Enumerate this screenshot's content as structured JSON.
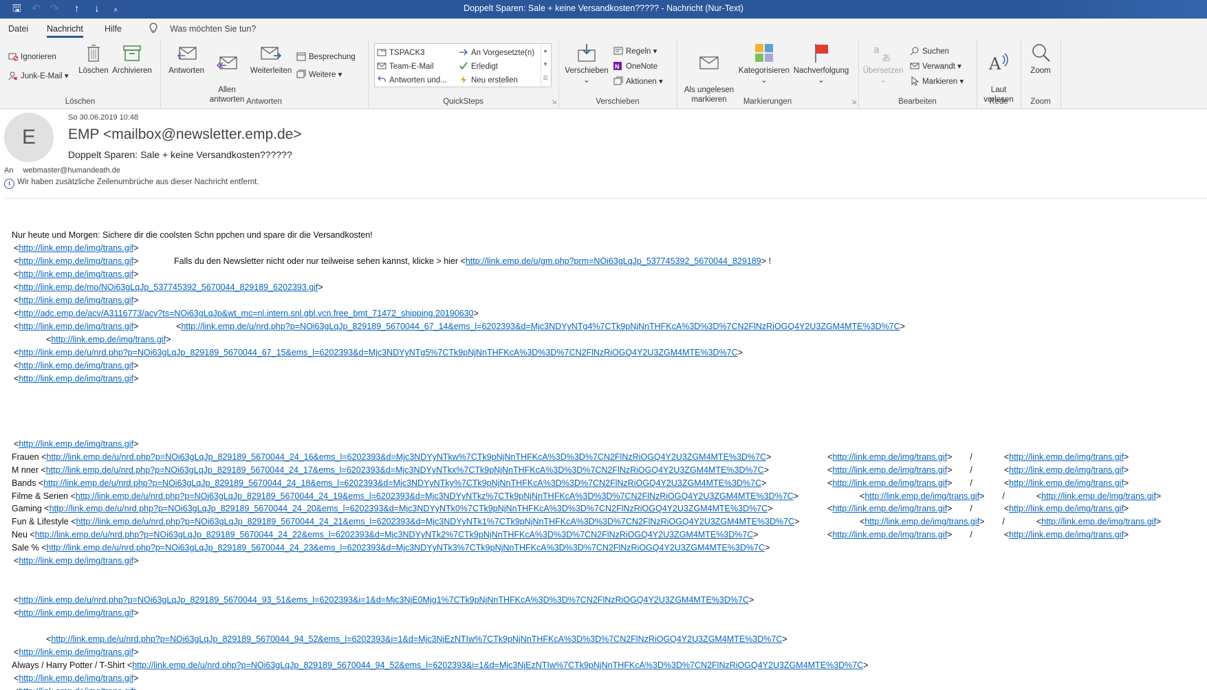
{
  "titlebar": {
    "title": "Doppelt Sparen: Sale + keine Versandkosten?????  -  Nachricht (Nur-Text)",
    "quick_access": {
      "save": "🖫",
      "undo": "↶",
      "redo": "↷",
      "up": "↑",
      "down": "↓",
      "customize": "⩡"
    }
  },
  "menu": {
    "tabs": [
      "Datei",
      "Nachricht",
      "Hilfe"
    ],
    "active_tab": "Nachricht",
    "tell_me_icon": "lightbulb-icon",
    "tell_me": "Was möchten Sie tun?"
  },
  "ribbon": {
    "loeschen": {
      "label": "Löschen",
      "ignorieren": "Ignorieren",
      "junk": "Junk-E-Mail",
      "loeschen_btn": "Löschen",
      "archivieren": "Archivieren"
    },
    "antworten": {
      "label": "Antworten",
      "antworten": "Antworten",
      "allen": "Allen\nantworten",
      "weiterleiten": "Weiterleiten",
      "besprechung": "Besprechung",
      "weitere": "Weitere"
    },
    "quicksteps": {
      "label": "QuickSteps",
      "items": [
        "TSPACK3",
        "Team-E-Mail",
        "Antworten und...",
        "An Vorgesetzte(n)",
        "Erledigt",
        "Neu erstellen"
      ]
    },
    "verschieben": {
      "label": "Verschieben",
      "verschieben": "Verschieben",
      "regeln": "Regeln",
      "onenote": "OneNote",
      "aktionen": "Aktionen"
    },
    "markierungen": {
      "label": "Markierungen",
      "ungelesen": "Als ungelesen\nmarkieren",
      "kategorisieren": "Kategorisieren",
      "nachverfolgung": "Nachverfolgung"
    },
    "bearbeiten": {
      "label": "Bearbeiten",
      "uebersetzen": "Übersetzen",
      "suchen": "Suchen",
      "verwandt": "Verwandt",
      "markieren": "Markieren"
    },
    "rede": {
      "label": "Rede",
      "laut": "Laut\nvorlesen"
    },
    "zoom": {
      "label": "Zoom",
      "zoom": "Zoom"
    }
  },
  "header": {
    "avatar_letter": "E",
    "date": "So 30.06.2019 10:48",
    "sender": "EMP <mailbox@newsletter.emp.de>",
    "subject": "Doppelt Sparen: Sale + keine Versandkosten??????",
    "to_label": "An",
    "to": "webmaster@humandeath.de",
    "info": "Wir haben zusätzliche Zeilenumbrüche aus dieser Nachricht entfernt."
  },
  "body": {
    "intro": "Nur heute und Morgen: Sichere dir die coolsten Schn ppchen und spare dir die Versandkosten!",
    "trans": "http://link.emp.de/img/trans.gif",
    "falls_text": "Falls du den Newsletter nicht oder nur teilweise sehen kannst, klicke > hier <",
    "falls_link": "http://link.emp.de/u/gm.php?prm=NOi63gLqJp_537745392_5670044_829189",
    "falls_end": "> !",
    "mo_link": "http://link.emp.de/mo/NOi63gLqJp_537745392_5670044_829189_6202393.gif",
    "acv_link": "http://adc.emp.de/acv/A3116773/acv?ts=NOi63gLqJp&wt_mc=nl.intern.snl.gbl.vcn.free_bmt_71472_shipping.20190630",
    "nrd_14": "http://link.emp.de/u/nrd.php?p=NOi63gLqJp_829189_5670044_67_14&ems_l=6202393&d=Mjc3NDYyNTg4%7CTk9pNjNnTHFKcA%3D%3D%7CN2FlNzRiOGQ4Y2U3ZGM4MTE%3D%7C",
    "nrd_15": "http://link.emp.de/u/nrd.php?p=NOi63gLqJp_829189_5670044_67_15&ems_l=6202393&d=Mjc3NDYyNTg5%7CTk9pNjNnTHFKcA%3D%3D%7CN2FlNzRiOGQ4Y2U3ZGM4MTE%3D%7C",
    "categories": [
      {
        "label": "Frauen",
        "link": "http://link.emp.de/u/nrd.php?p=NOi63gLqJp_829189_5670044_24_16&ems_l=6202393&d=Mjc3NDYyNTkw%7CTk9pNjNnTHFKcA%3D%3D%7CN2FlNzRiOGQ4Y2U3ZGM4MTE%3D%7C"
      },
      {
        "label": "M nner",
        "link": "http://link.emp.de/u/nrd.php?p=NOi63gLqJp_829189_5670044_24_17&ems_l=6202393&d=Mjc3NDYyNTkx%7CTk9pNjNnTHFKcA%3D%3D%7CN2FlNzRiOGQ4Y2U3ZGM4MTE%3D%7C"
      },
      {
        "label": "Bands",
        "link": "http://link.emp.de/u/nrd.php?p=NOi63gLqJp_829189_5670044_24_18&ems_l=6202393&d=Mjc3NDYyNTky%7CTk9pNjNnTHFKcA%3D%3D%7CN2FlNzRiOGQ4Y2U3ZGM4MTE%3D%7C"
      },
      {
        "label": "Filme & Serien",
        "link": "http://link.emp.de/u/nrd.php?p=NOi63gLqJp_829189_5670044_24_19&ems_l=6202393&d=Mjc3NDYyNTkz%7CTk9pNjNnTHFKcA%3D%3D%7CN2FlNzRiOGQ4Y2U3ZGM4MTE%3D%7C"
      },
      {
        "label": "Gaming",
        "link": "http://link.emp.de/u/nrd.php?p=NOi63gLqJp_829189_5670044_24_20&ems_l=6202393&d=Mjc3NDYyNTk0%7CTk9pNjNnTHFKcA%3D%3D%7CN2FlNzRiOGQ4Y2U3ZGM4MTE%3D%7C"
      },
      {
        "label": "Fun & Lifestyle",
        "link": "http://link.emp.de/u/nrd.php?p=NOi63gLqJp_829189_5670044_24_21&ems_l=6202393&d=Mjc3NDYyNTk1%7CTk9pNjNnTHFKcA%3D%3D%7CN2FlNzRiOGQ4Y2U3ZGM4MTE%3D%7C"
      },
      {
        "label": "Neu",
        "link": "http://link.emp.de/u/nrd.php?p=NOi63gLqJp_829189_5670044_24_22&ems_l=6202393&d=Mjc3NDYyNTk2%7CTk9pNjNnTHFKcA%3D%3D%7CN2FlNzRiOGQ4Y2U3ZGM4MTE%3D%7C"
      },
      {
        "label": "Sale %",
        "link": "http://link.emp.de/u/nrd.php?p=NOi63gLqJp_829189_5670044_24_23&ems_l=6202393&d=Mjc3NDYyNTk3%7CTk9pNjNnTHFKcA%3D%3D%7CN2FlNzRiOGQ4Y2U3ZGM4MTE%3D%7C"
      }
    ],
    "slash": "/",
    "nrd_93": "http://link.emp.de/u/nrd.php?p=NOi63gLqJp_829189_5670044_93_51&ems_l=6202393&i=1&d=Mjc3NjE0Mjg1%7CTk9pNjNnTHFKcA%3D%3D%7CN2FlNzRiOGQ4Y2U3ZGM4MTE%3D%7C",
    "nrd_94": "http://link.emp.de/u/nrd.php?p=NOi63gLqJp_829189_5670044_94_52&ems_l=6202393&i=1&d=Mjc3NjEzNTIw%7CTk9pNjNnTHFKcA%3D%3D%7CN2FlNzRiOGQ4Y2U3ZGM4MTE%3D%7C",
    "harry_label": "Always / Harry Potter / T-Shirt"
  }
}
